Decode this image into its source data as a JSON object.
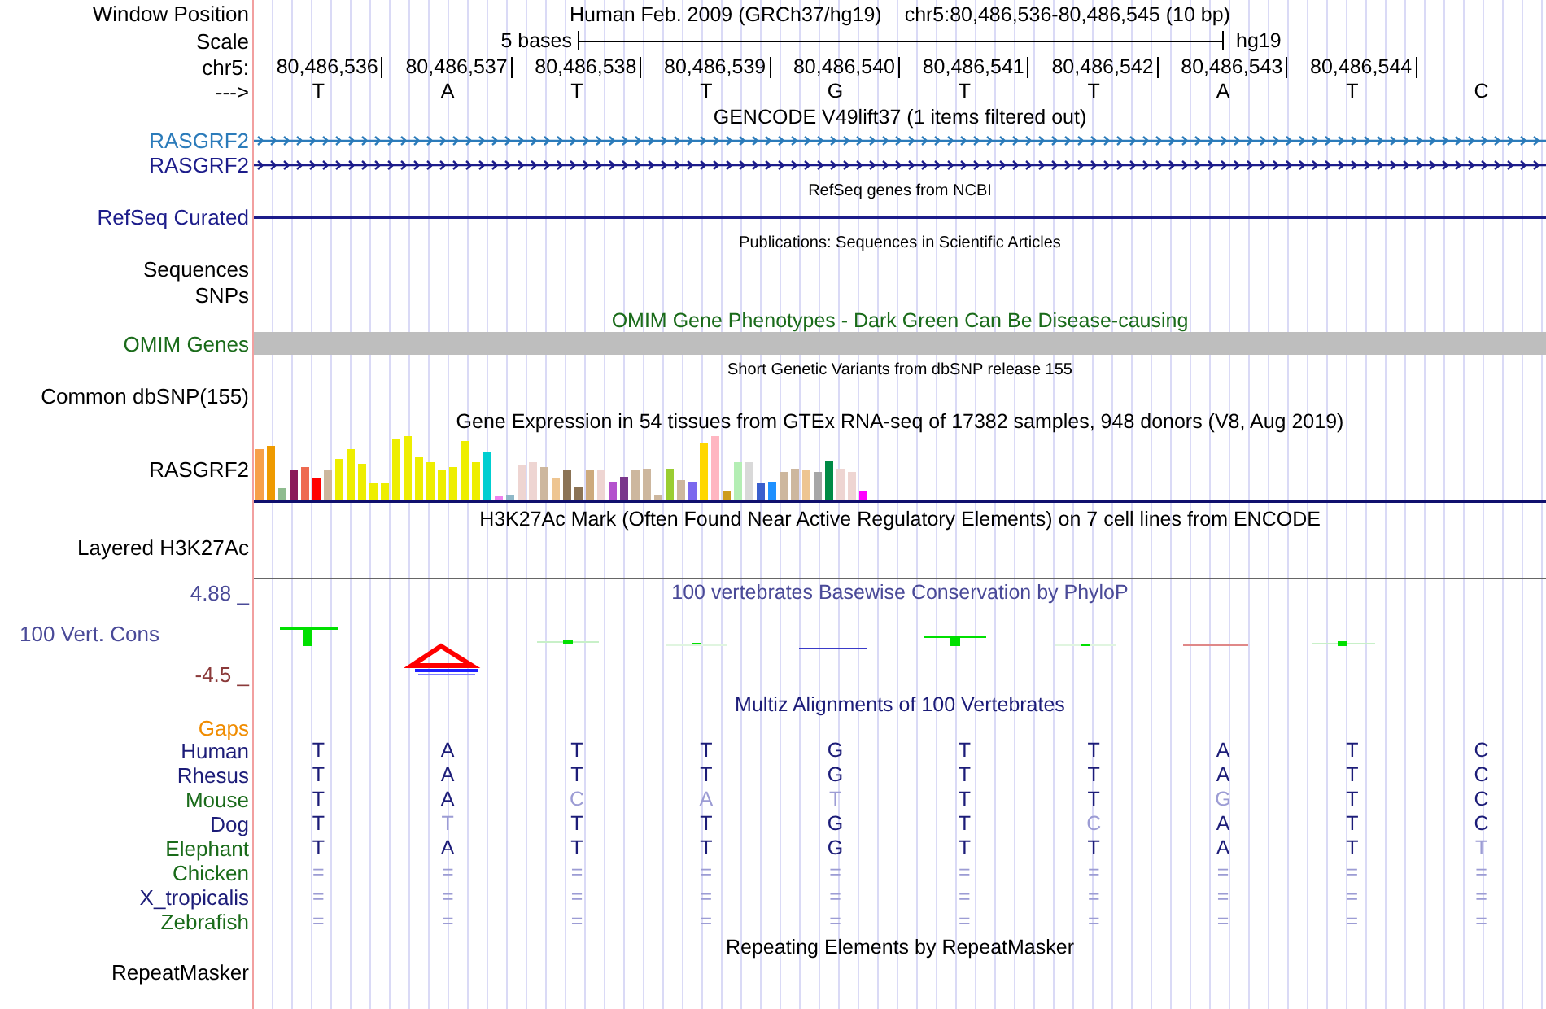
{
  "ruler": {
    "label": "Window Position",
    "assembly": "Human Feb. 2009 (GRCh37/hg19)",
    "position": "chr5:80,486,536-80,486,545 (10 bp)"
  },
  "scale": {
    "label": "Scale",
    "text": "5 bases",
    "assembly": "hg19"
  },
  "coordinates": {
    "label": "chr5:",
    "values": [
      "80,486,536",
      "80,486,537",
      "80,486,538",
      "80,486,539",
      "80,486,540",
      "80,486,541",
      "80,486,542",
      "80,486,543",
      "80,486,544"
    ]
  },
  "sequence": {
    "label": "--->",
    "bases": [
      "T",
      "A",
      "T",
      "T",
      "G",
      "T",
      "T",
      "A",
      "T",
      "C"
    ]
  },
  "tracks": [
    {
      "kind": "genes",
      "title": "GENCODE V49lift37 (1 items filtered out)",
      "rows": [
        {
          "label": "RASGRF2",
          "color": "#2b7bba"
        },
        {
          "label": "RASGRF2",
          "color": "#1c1c8a"
        }
      ]
    },
    {
      "kind": "line",
      "title": "RefSeq genes from NCBI",
      "label": "RefSeq Curated",
      "color": "#1c1c8a"
    },
    {
      "kind": "empty",
      "title": "Publications: Sequences in Scientific Articles",
      "labels": [
        "Sequences",
        "SNPs"
      ]
    },
    {
      "kind": "bar",
      "title": "OMIM Gene Phenotypes - Dark Green Can Be Disease-causing",
      "label": "OMIM Genes",
      "color": "#1a6b1a"
    },
    {
      "kind": "empty",
      "title": "Short Genetic Variants from dbSNP release 155",
      "labels": [
        "Common dbSNP(155)"
      ]
    },
    {
      "kind": "expression",
      "title": "Gene Expression in 54 tissues from GTEx RNA-seq of 17382 samples, 948 donors (V8, Aug 2019)",
      "label": "RASGRF2"
    },
    {
      "kind": "layered",
      "title": "H3K27Ac Mark (Often Found Near Active Regulatory Elements) on 7 cell lines from ENCODE",
      "label": "Layered H3K27Ac"
    },
    {
      "kind": "wiggle",
      "title": "100 vertebrates Basewise Conservation by PhyloP",
      "label": "100 Vert. Cons",
      "max": "4.88 _",
      "min": "-4.5 _",
      "color": "#4a4a98"
    },
    {
      "kind": "alignment",
      "title": "Multiz Alignments of 100 Vertebrates",
      "gaps_label": "Gaps",
      "color": "#1c1c78",
      "species": [
        {
          "name": "Human",
          "color": "#1c1c78",
          "bases": [
            {
              "base": "T",
              "match": true
            },
            {
              "base": "A",
              "match": true
            },
            {
              "base": "T",
              "match": true
            },
            {
              "base": "T",
              "match": true
            },
            {
              "base": "G",
              "match": true
            },
            {
              "base": "T",
              "match": true
            },
            {
              "base": "T",
              "match": true
            },
            {
              "base": "A",
              "match": true
            },
            {
              "base": "T",
              "match": true
            },
            {
              "base": "C",
              "match": true
            }
          ]
        },
        {
          "name": "Rhesus",
          "color": "#1c1c78",
          "bases": [
            {
              "base": "T",
              "match": true
            },
            {
              "base": "A",
              "match": true
            },
            {
              "base": "T",
              "match": true
            },
            {
              "base": "T",
              "match": true
            },
            {
              "base": "G",
              "match": true
            },
            {
              "base": "T",
              "match": true
            },
            {
              "base": "T",
              "match": true
            },
            {
              "base": "A",
              "match": true
            },
            {
              "base": "T",
              "match": true
            },
            {
              "base": "C",
              "match": true
            }
          ]
        },
        {
          "name": "Mouse",
          "color": "#1a6b1a",
          "bases": [
            {
              "base": "T",
              "match": true
            },
            {
              "base": "A",
              "match": true
            },
            {
              "base": "C",
              "match": false
            },
            {
              "base": "A",
              "match": false
            },
            {
              "base": "T",
              "match": false
            },
            {
              "base": "T",
              "match": true
            },
            {
              "base": "T",
              "match": true
            },
            {
              "base": "G",
              "match": false
            },
            {
              "base": "T",
              "match": true
            },
            {
              "base": "C",
              "match": true
            }
          ]
        },
        {
          "name": "Dog",
          "color": "#1c1c78",
          "bases": [
            {
              "base": "T",
              "match": true
            },
            {
              "base": "T",
              "match": false
            },
            {
              "base": "T",
              "match": true
            },
            {
              "base": "T",
              "match": true
            },
            {
              "base": "G",
              "match": true
            },
            {
              "base": "T",
              "match": true
            },
            {
              "base": "C",
              "match": false
            },
            {
              "base": "A",
              "match": true
            },
            {
              "base": "T",
              "match": true
            },
            {
              "base": "C",
              "match": true
            }
          ]
        },
        {
          "name": "Elephant",
          "color": "#1a6b1a",
          "bases": [
            {
              "base": "T",
              "match": true
            },
            {
              "base": "A",
              "match": true
            },
            {
              "base": "T",
              "match": true
            },
            {
              "base": "T",
              "match": true
            },
            {
              "base": "G",
              "match": true
            },
            {
              "base": "T",
              "match": true
            },
            {
              "base": "T",
              "match": true
            },
            {
              "base": "A",
              "match": true
            },
            {
              "base": "T",
              "match": true
            },
            {
              "base": "T",
              "match": false
            }
          ]
        },
        {
          "name": "Chicken",
          "color": "#1a6b1a",
          "bases": [
            {
              "base": "=",
              "match": false
            },
            {
              "base": "=",
              "match": false
            },
            {
              "base": "=",
              "match": false
            },
            {
              "base": "=",
              "match": false
            },
            {
              "base": "=",
              "match": false
            },
            {
              "base": "=",
              "match": false
            },
            {
              "base": "=",
              "match": false
            },
            {
              "base": "=",
              "match": false
            },
            {
              "base": "=",
              "match": false
            },
            {
              "base": "=",
              "match": false
            }
          ]
        },
        {
          "name": "X_tropicalis",
          "color": "#1c1c78",
          "bases": [
            {
              "base": "=",
              "match": false
            },
            {
              "base": "=",
              "match": false
            },
            {
              "base": "=",
              "match": false
            },
            {
              "base": "=",
              "match": false
            },
            {
              "base": "=",
              "match": false
            },
            {
              "base": "=",
              "match": false
            },
            {
              "base": "=",
              "match": false
            },
            {
              "base": "=",
              "match": false
            },
            {
              "base": "=",
              "match": false
            },
            {
              "base": "=",
              "match": false
            }
          ]
        },
        {
          "name": "Zebrafish",
          "color": "#1a6b1a",
          "bases": [
            {
              "base": "=",
              "match": false
            },
            {
              "base": "=",
              "match": false
            },
            {
              "base": "=",
              "match": false
            },
            {
              "base": "=",
              "match": false
            },
            {
              "base": "=",
              "match": false
            },
            {
              "base": "=",
              "match": false
            },
            {
              "base": "=",
              "match": false
            },
            {
              "base": "=",
              "match": false
            },
            {
              "base": "=",
              "match": false
            },
            {
              "base": "=",
              "match": false
            }
          ]
        }
      ]
    },
    {
      "kind": "repeats",
      "title": "Repeating Elements by RepeatMasker",
      "label": "RepeatMasker"
    }
  ]
}
